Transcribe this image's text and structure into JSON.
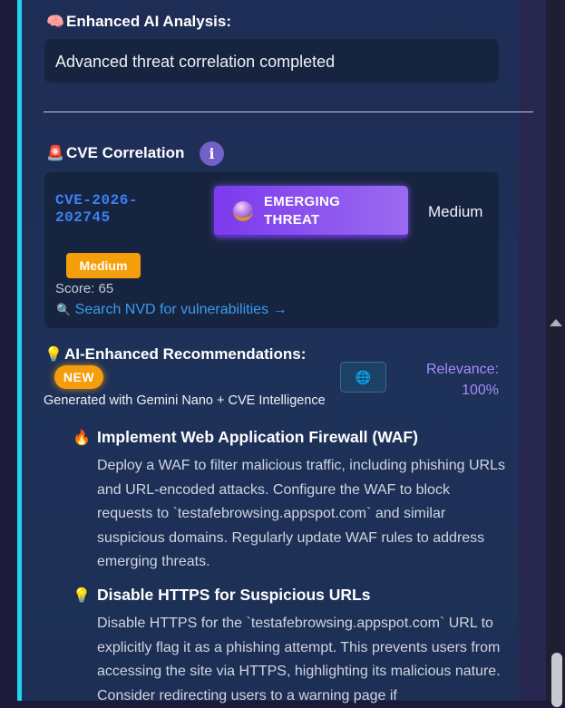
{
  "analysis": {
    "icon": "brain-icon",
    "title": "Enhanced AI Analysis:",
    "text": "Advanced threat correlation completed"
  },
  "cve": {
    "icon": "siren-icon",
    "title": "CVE Correlation",
    "info_glyph": "i",
    "id": "CVE-2026-202745",
    "threat_label": "EMERGING THREAT",
    "severity_text": "Medium",
    "severity_badge": "Medium",
    "score": "Score: 65",
    "search_link": "Search NVD for vulnerabilities →"
  },
  "recommendations": {
    "icon": "lightbulb-icon",
    "title": "AI-Enhanced Recommendations:",
    "new_badge": "NEW",
    "generated_by": "Generated with Gemini Nano + CVE Intelligence",
    "relevance_label": "Relevance:",
    "relevance_value": "100%",
    "items": [
      {
        "icon": "fire-icon",
        "title": "Implement Web Application Firewall (WAF)",
        "body": "Deploy a WAF to filter malicious traffic, including phishing URLs and URL-encoded attacks. Configure the WAF to block requests to `testafebrowsing.appspot.com` and similar suspicious domains. Regularly update WAF rules to address emerging threats."
      },
      {
        "icon": "lightbulb-icon",
        "title": "Disable HTTPS for Suspicious URLs",
        "body": "Disable HTTPS for the `testafebrowsing.appspot.com` URL to explicitly flag it as a phishing attempt. This prevents users from accessing the site via HTTPS, highlighting its malicious nature. Consider redirecting users to a warning page if"
      }
    ]
  },
  "colors": {
    "accent": "#22d3ee",
    "cve_id": "#3b82f6",
    "threat": "#7c3aed",
    "warning": "#f59e0b",
    "relevance": "#a78bfa",
    "link": "#3b9bf0"
  }
}
